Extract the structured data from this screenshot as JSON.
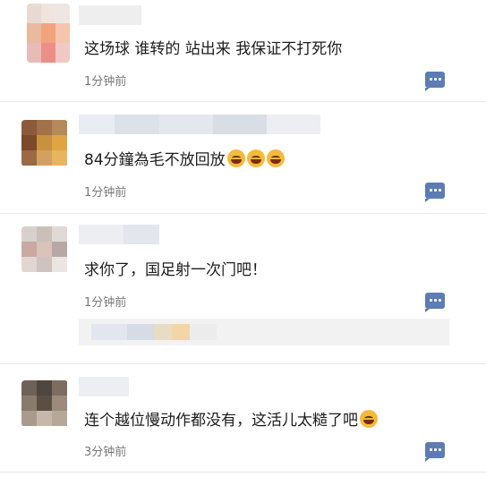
{
  "comments": [
    {
      "text": "这场球 谁转的 站出来 我保证不打死你",
      "time": "1分钟前",
      "emoji_count": 0
    },
    {
      "text": "84分鐘為毛不放回放",
      "time": "1分钟前",
      "emoji_count": 3
    },
    {
      "text": "求你了，国足射一次门吧！",
      "time": "1分钟前",
      "emoji_count": 0
    },
    {
      "text": "连个越位慢动作都没有，这活儿太糙了吧",
      "time": "3分钟前",
      "emoji_count": 1
    }
  ],
  "icons": {
    "reply": "comment-reply-icon",
    "emoji": "laughing-emoji-icon"
  },
  "colors": {
    "reply_button": "#5c7cb4",
    "timestamp": "#777777",
    "divider": "#e6e6e6"
  }
}
